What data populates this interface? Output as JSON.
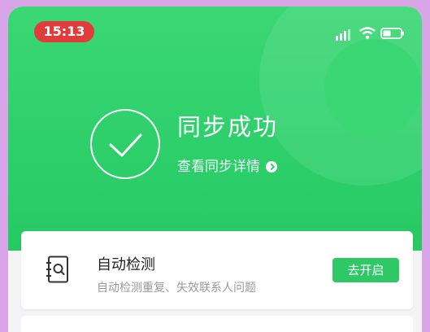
{
  "status_bar": {
    "time": "15:13",
    "icons": [
      "signal-icon",
      "wifi-icon",
      "battery-icon"
    ]
  },
  "hero": {
    "title": "同步成功",
    "detail_link": "查看同步详情",
    "icon": "checkmark-circle-icon",
    "accent": "#2ed06c"
  },
  "card": {
    "icon": "contact-search-icon",
    "title": "自动检测",
    "description": "自动检测重复、失效联系人问题",
    "button_label": "去开启"
  },
  "colors": {
    "green": "#2ed06c",
    "time_pill": "#e23b3b",
    "frame": "#d8a6e6"
  }
}
